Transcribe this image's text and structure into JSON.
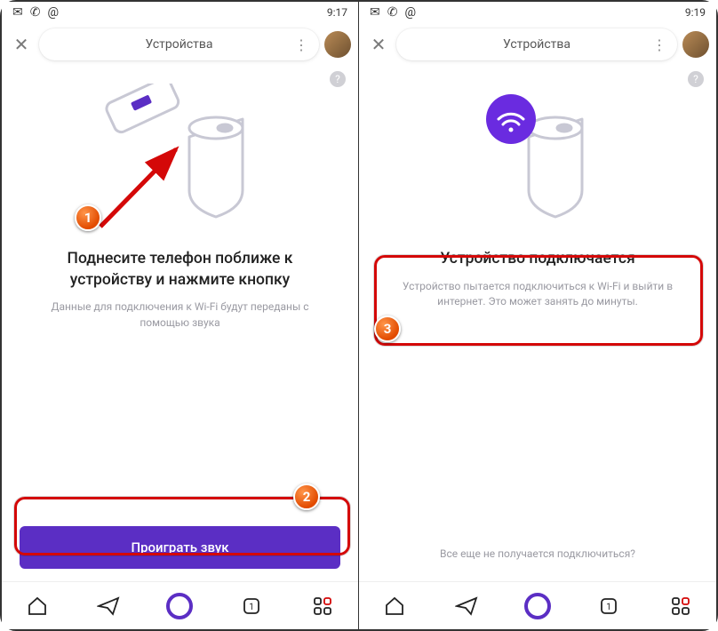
{
  "left": {
    "status": {
      "time": "9:17"
    },
    "header": {
      "title": "Устройства"
    },
    "help": "?",
    "heading": "Поднесите телефон поближе к устройству и нажмите кнопку",
    "sub": "Данные для подключения к Wi-Fi будут переданы с помощью звука",
    "button": "Проиграть звук"
  },
  "right": {
    "status": {
      "time": "9:19"
    },
    "header": {
      "title": "Устройства"
    },
    "help": "?",
    "heading": "Устройство подключается",
    "sub": "Устройство пытается подключиться к Wi-Fi и выйти в интернет. Это может занять до минуты.",
    "troubleshoot": "Все еще не получается подключиться?"
  },
  "badges": {
    "n1": "1",
    "n2": "2",
    "n3": "3"
  }
}
